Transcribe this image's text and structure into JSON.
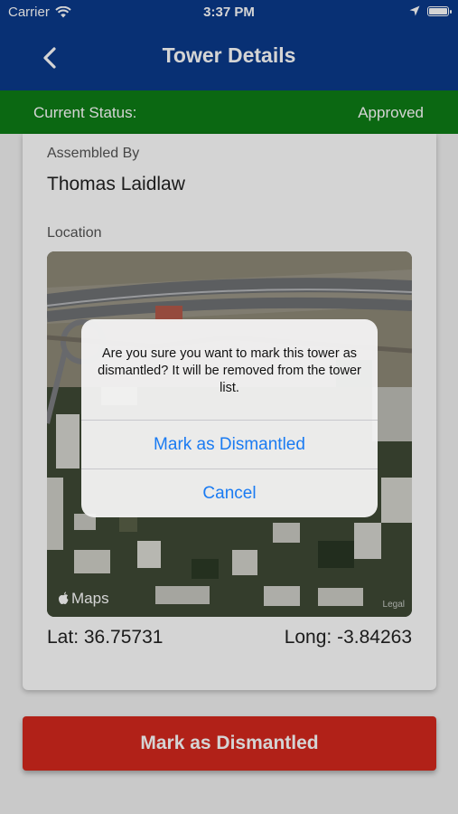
{
  "status_bar": {
    "carrier": "Carrier",
    "time": "3:37 PM",
    "battery_percent": 100
  },
  "nav": {
    "title": "Tower Details"
  },
  "status_banner": {
    "label": "Current Status:",
    "value": "Approved"
  },
  "details": {
    "assembled_by_label": "Assembled By",
    "assembled_by_value": "Thomas Laidlaw",
    "location_label": "Location",
    "map_brand": "Maps",
    "map_legal": "Legal",
    "lat": "Lat: 36.75731",
    "long": "Long: -3.84263"
  },
  "primary_button": {
    "label": "Mark as Dismantled"
  },
  "alert": {
    "message": "Are you sure you want to mark this tower as dismantled? It will be removed from the tower list.",
    "confirm_label": "Mark as Dismantled",
    "cancel_label": "Cancel"
  },
  "colors": {
    "nav_blue": "#0a3a8c",
    "status_green": "#0e7d16",
    "button_red": "#d5281d",
    "alert_blue": "#1a7bf2"
  }
}
